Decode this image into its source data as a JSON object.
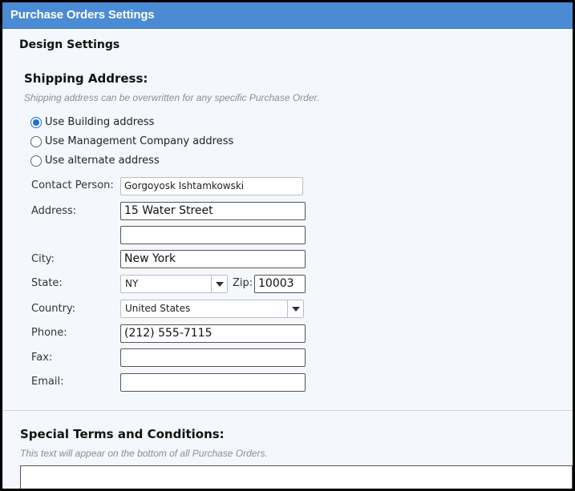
{
  "window": {
    "title": "Purchase Orders Settings"
  },
  "section_title": "Design Settings",
  "shipping": {
    "heading": "Shipping Address:",
    "hint": "Shipping address can be overwritten for any specific Purchase Order.",
    "options": [
      {
        "label": "Use Building address",
        "checked": true
      },
      {
        "label": "Use Management Company address",
        "checked": false
      },
      {
        "label": "Use alternate address",
        "checked": false
      }
    ],
    "fields": {
      "contact_label": "Contact Person:",
      "contact_value": "Gorgoyosk  Ishtamkowski",
      "address_label": "Address:",
      "address1_value": "15 Water Street",
      "address2_value": "",
      "city_label": "City:",
      "city_value": "New York",
      "state_label": "State:",
      "state_value": "NY",
      "zip_label": "Zip:",
      "zip_value": "10003",
      "country_label": "Country:",
      "country_value": "United States",
      "phone_label": "Phone:",
      "phone_value": "(212) 555-7115",
      "fax_label": "Fax:",
      "fax_value": "",
      "email_label": "Email:",
      "email_value": ""
    }
  },
  "terms": {
    "heading": "Special Terms and Conditions:",
    "hint": "This text will appear on the bottom of all Purchase Orders.",
    "value": ""
  },
  "colors": {
    "titlebar": "#4a8bd4",
    "radio_accent": "#1a6fd8"
  },
  "icons": {
    "dropdown": "chevron-down-icon"
  }
}
